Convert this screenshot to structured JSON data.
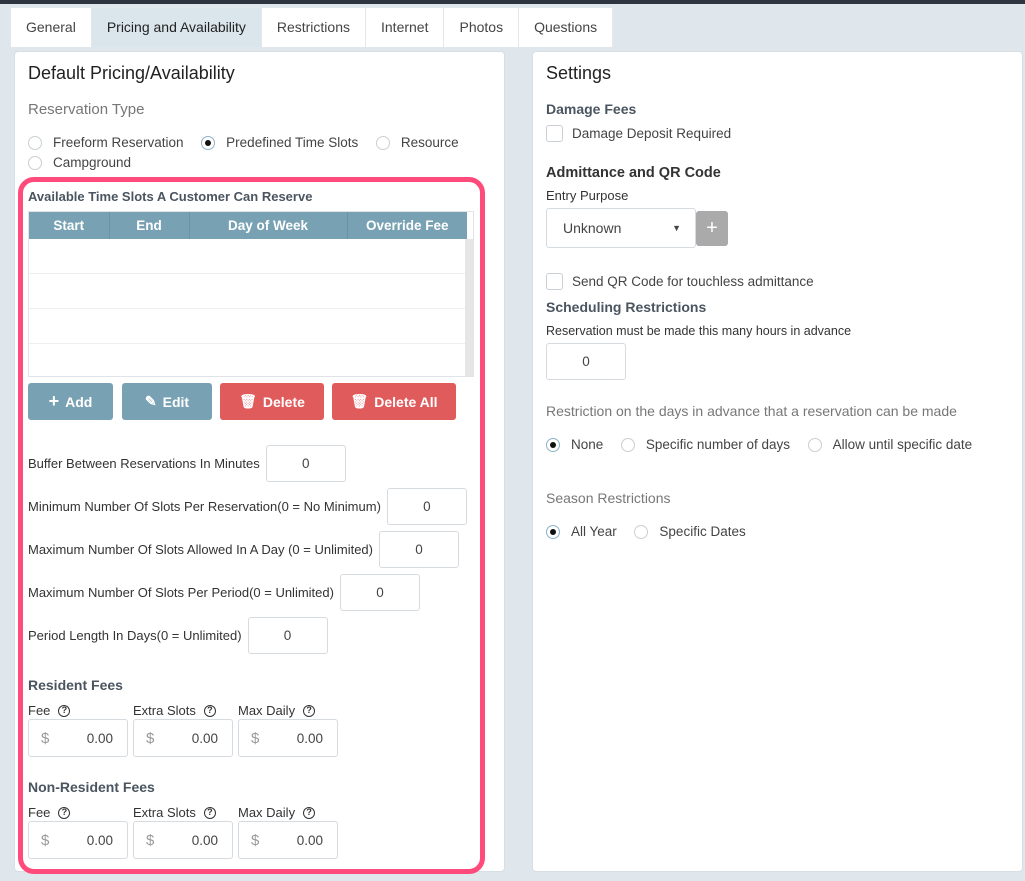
{
  "tabs": [
    "General",
    "Pricing and Availability",
    "Restrictions",
    "Internet",
    "Photos",
    "Questions"
  ],
  "left": {
    "title": "Default Pricing/Availability",
    "reservation_type_label": "Reservation Type",
    "reservation_types": [
      "Freeform Reservation",
      "Predefined Time Slots",
      "Resource",
      "Campground"
    ],
    "selected_type": "Predefined Time Slots",
    "slots_title": "Available Time Slots A Customer Can Reserve",
    "columns": [
      "Start",
      "End",
      "Day of Week",
      "Override Fee"
    ],
    "buttons": {
      "add": "Add",
      "edit": "Edit",
      "delete": "Delete",
      "delete_all": "Delete All"
    },
    "fields": [
      {
        "label": "Buffer Between Reservations In Minutes",
        "value": "0"
      },
      {
        "label": "Minimum Number Of Slots Per Reservation(0 = No Minimum)",
        "value": "0"
      },
      {
        "label": "Maximum Number Of Slots Allowed In A Day (0 = Unlimited)",
        "value": "0"
      },
      {
        "label": "Maximum Number Of Slots Per Period(0 = Unlimited)",
        "value": "0"
      },
      {
        "label": "Period Length In Days(0 = Unlimited)",
        "value": "0"
      }
    ],
    "resident": {
      "title": "Resident Fees",
      "labels": [
        "Fee",
        "Extra Slots",
        "Max Daily"
      ],
      "values": [
        "0.00",
        "0.00",
        "0.00"
      ]
    },
    "nonresident": {
      "title": "Non-Resident Fees",
      "labels": [
        "Fee",
        "Extra Slots",
        "Max Daily"
      ],
      "values": [
        "0.00",
        "0.00",
        "0.00"
      ]
    },
    "currency": "$",
    "help_glyph": "?"
  },
  "right": {
    "title": "Settings",
    "damage_title": "Damage Fees",
    "damage_check": "Damage Deposit Required",
    "admit_title": "Admittance and QR Code",
    "entry_label": "Entry Purpose",
    "entry_value": "Unknown",
    "add_glyph": "+",
    "qr_check": "Send QR Code for touchless admittance",
    "sched_title": "Scheduling Restrictions",
    "hours_label": "Reservation must be made this many hours in advance",
    "hours_value": "0",
    "days_label": "Restriction on the days in advance that a reservation can be made",
    "days_options": [
      "None",
      "Specific number of days",
      "Allow until specific date"
    ],
    "season_label": "Season Restrictions",
    "season_options": [
      "All Year",
      "Specific Dates"
    ]
  },
  "colors": {
    "accent": "#78a2b4",
    "danger": "#e05c5c",
    "highlight": "#ff4b7b"
  }
}
